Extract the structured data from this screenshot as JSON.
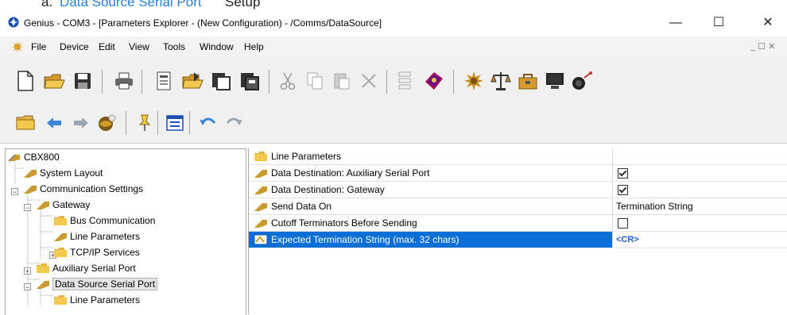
{
  "doc_heading": {
    "label": "a.",
    "link": "Data Source Serial Port",
    "suffix": "Setup"
  },
  "window": {
    "title": "Genius - COM3 - [Parameters Explorer - (New Configuration) - /Comms/DataSource]",
    "minimize": "—",
    "maximize": "☐",
    "close": "✕"
  },
  "menu": {
    "items": [
      "File",
      "Device",
      "Edit",
      "View",
      "Tools",
      "Window",
      "Help"
    ],
    "mdi_controls": "_ ☐ ✕"
  },
  "toolbar1": {
    "buttons": [
      {
        "icon": "new-document-icon"
      },
      {
        "icon": "open-folder-icon"
      },
      {
        "icon": "save-icon"
      },
      {
        "icon": "print-icon"
      },
      {
        "icon": "properties-icon"
      },
      {
        "icon": "receive-configuration-icon"
      },
      {
        "icon": "send-configuration-icon"
      },
      {
        "icon": "send-permanent-icon"
      },
      {
        "icon": "cut-icon"
      },
      {
        "icon": "copy-icon"
      },
      {
        "icon": "paste-icon"
      },
      {
        "icon": "delete-icon"
      },
      {
        "icon": "align-icon"
      },
      {
        "icon": "book-icon"
      },
      {
        "icon": "settings-icon"
      },
      {
        "icon": "scale-icon"
      },
      {
        "icon": "tools-icon"
      },
      {
        "icon": "monitor-icon"
      },
      {
        "icon": "network-icon"
      }
    ]
  },
  "toolbar2": {
    "buttons": [
      {
        "icon": "folder-icon"
      },
      {
        "icon": "back-arrow-icon"
      },
      {
        "icon": "forward-arrow-icon"
      },
      {
        "icon": "globe-icon"
      },
      {
        "icon": "pin-icon"
      },
      {
        "icon": "parameters-window-icon"
      },
      {
        "icon": "undo-icon"
      },
      {
        "icon": "redo-icon"
      }
    ]
  },
  "tree": {
    "nodes": [
      {
        "label": "CBX800",
        "icon": "device-icon",
        "level": 0
      },
      {
        "label": "System Layout",
        "icon": "parameter-group-icon",
        "level": 1
      },
      {
        "label": "Communication Settings",
        "icon": "parameter-group-icon",
        "level": 1,
        "expander": "−"
      },
      {
        "label": "Gateway",
        "icon": "parameter-group-icon",
        "level": 2,
        "expander": "−"
      },
      {
        "label": "Bus Communication",
        "icon": "folder-icon",
        "level": 3
      },
      {
        "label": "Line Parameters",
        "icon": "parameter-group-icon",
        "level": 3
      },
      {
        "label": "TCP/IP Services",
        "icon": "folder-icon",
        "level": 3,
        "expander": "+"
      },
      {
        "label": "Auxiliary Serial Port",
        "icon": "folder-icon",
        "level": 2,
        "expander": "+"
      },
      {
        "label": "Data Source Serial Port",
        "icon": "parameter-group-icon",
        "level": 2,
        "expander": "−",
        "selected": true
      },
      {
        "label": "Line Parameters",
        "icon": "folder-icon",
        "level": 3
      }
    ]
  },
  "grid": {
    "rows": [
      {
        "name": "Line Parameters",
        "icon": "folder-icon",
        "value": "",
        "type": "folder"
      },
      {
        "name": "Data Destination: Auxiliary Serial Port",
        "icon": "parameter-icon",
        "value": "checked",
        "type": "checkbox"
      },
      {
        "name": "Data Destination: Gateway",
        "icon": "parameter-icon",
        "value": "checked",
        "type": "checkbox"
      },
      {
        "name": "Send Data On",
        "icon": "parameter-icon",
        "value": "Termination String",
        "type": "text"
      },
      {
        "name": "Cutoff Terminators Before Sending",
        "icon": "parameter-icon",
        "value": "unchecked",
        "type": "checkbox"
      },
      {
        "name": "Expected Termination String (max. 32 chars)",
        "icon": "string-parameter-icon",
        "value": "<CR>",
        "type": "text",
        "selected": true
      }
    ]
  },
  "colors": {
    "selection": "#0a6fd6",
    "value_highlight": "#1e5fd2",
    "link": "#2a7fd4",
    "folder": "#e8b54a",
    "parameter": "#c99a2e"
  }
}
